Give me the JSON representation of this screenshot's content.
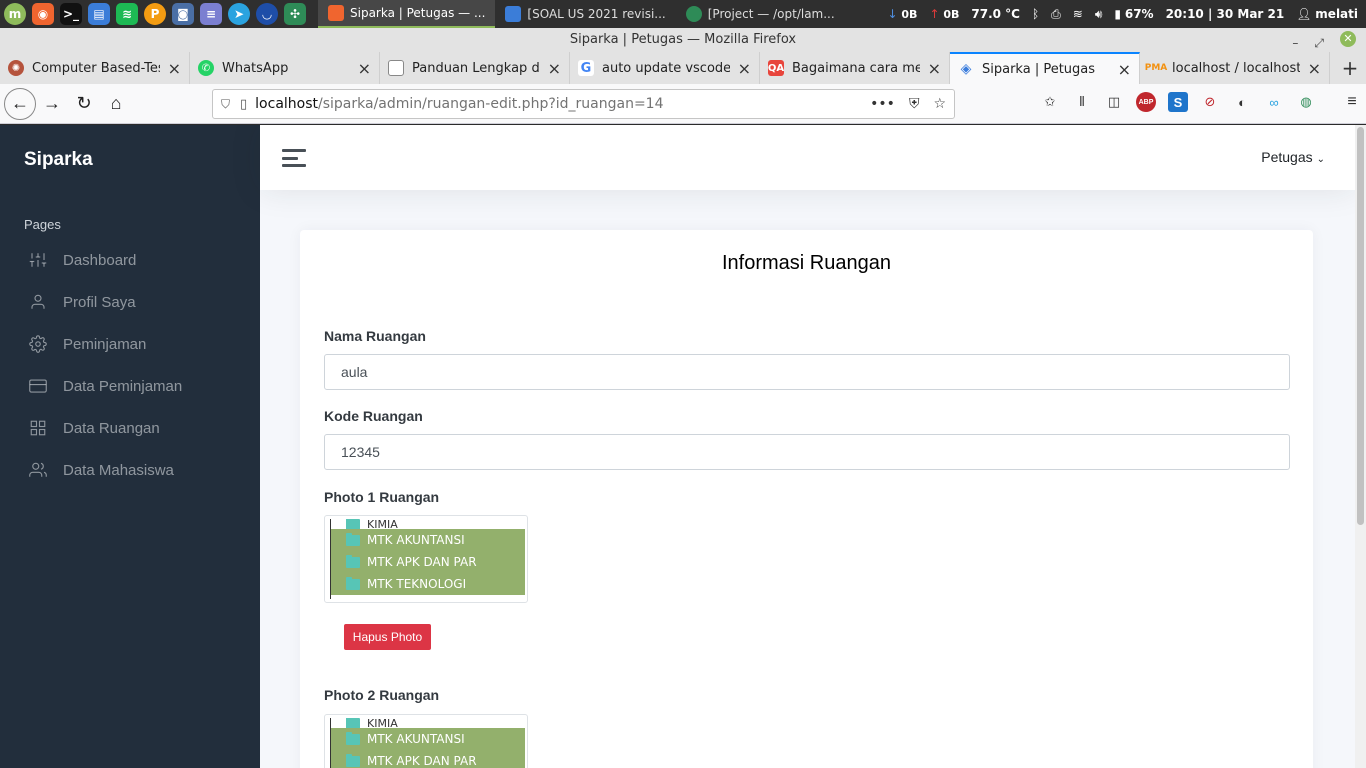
{
  "os": {
    "windows": [
      {
        "label": "Siparka | Petugas — ...",
        "active": true
      },
      {
        "label": "[SOAL US 2021 revisi...",
        "active": false
      },
      {
        "label": "[Project — /opt/lam...",
        "active": false
      }
    ],
    "net_down": "0B",
    "net_up": "0B",
    "temperature": "77.0 °C",
    "battery": "67%",
    "clock": "20:10 | 30 Mar 21",
    "user": "melati"
  },
  "browser": {
    "window_title": "Siparka | Petugas — Mozilla Firefox",
    "tabs": [
      {
        "label": "Computer Based-Test",
        "icon": "cbt-favicon",
        "active": false
      },
      {
        "label": "WhatsApp",
        "icon": "whatsapp-favicon",
        "active": false
      },
      {
        "label": "Panduan Lengkap dan",
        "icon": "doc-favicon",
        "active": false
      },
      {
        "label": "auto update vscode li",
        "icon": "google-favicon",
        "active": false
      },
      {
        "label": "Bagaimana cara mem",
        "icon": "qa-favicon",
        "active": false
      },
      {
        "label": "Siparka | Petugas",
        "icon": "layers-favicon",
        "active": true
      },
      {
        "label": "localhost / localhost /",
        "icon": "phpmyadmin-favicon",
        "active": false
      }
    ],
    "url_host": "localhost",
    "url_path": "/siparka/admin/ruangan-edit.php?id_ruangan=14"
  },
  "sidebar": {
    "brand": "Siparka",
    "section": "Pages",
    "items": [
      {
        "label": "Dashboard",
        "icon": "sliders-icon"
      },
      {
        "label": "Profil Saya",
        "icon": "user-icon"
      },
      {
        "label": "Peminjaman",
        "icon": "settings-icon"
      },
      {
        "label": "Data Peminjaman",
        "icon": "credit-card-icon"
      },
      {
        "label": "Data Ruangan",
        "icon": "grid-icon"
      },
      {
        "label": "Data Mahasiswa",
        "icon": "users-icon"
      }
    ]
  },
  "topbar": {
    "user_label": "Petugas"
  },
  "form": {
    "title": "Informasi Ruangan",
    "nama_label": "Nama Ruangan",
    "nama_value": "aula",
    "kode_label": "Kode Ruangan",
    "kode_value": "12345",
    "photo1_label": "Photo 1 Ruangan",
    "photo2_label": "Photo 2 Ruangan",
    "delete_photo_label": "Hapus Photo",
    "photo_thumb_rows": [
      "KIMIA",
      "MTK AKUNTANSI",
      "MTK APK DAN PAR",
      "MTK TEKNOLOGI"
    ]
  }
}
